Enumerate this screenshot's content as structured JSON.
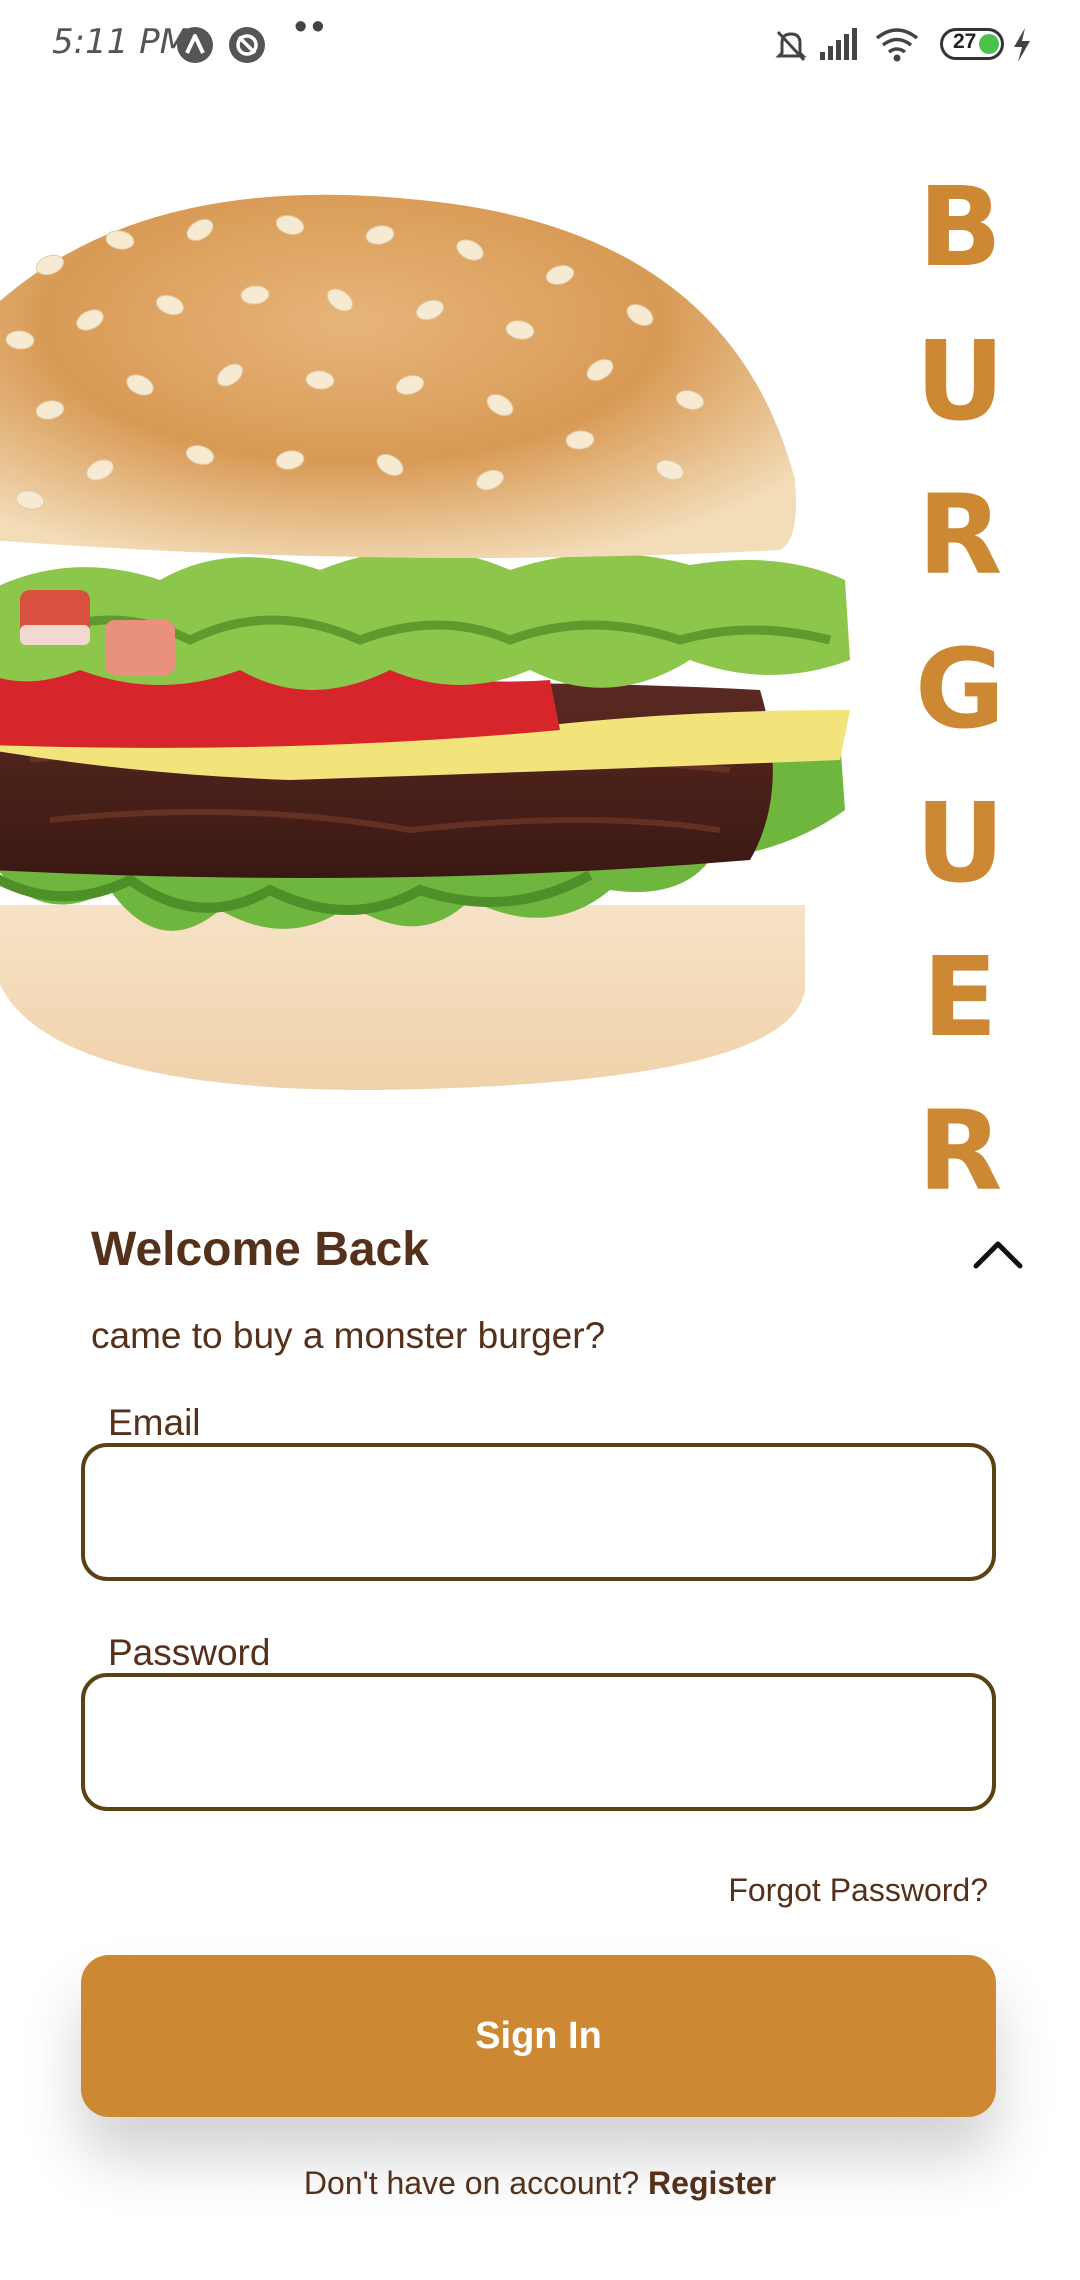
{
  "status_bar": {
    "time": "5:11 PM",
    "dots": "••",
    "battery_level": "27",
    "icons": [
      "app-icon-a",
      "app-icon-block",
      "mute-bell-icon",
      "signal-icon",
      "wifi-icon",
      "battery-icon",
      "charging-icon"
    ]
  },
  "hero": {
    "brand_letters": [
      "B",
      "U",
      "R",
      "G",
      "U",
      "E",
      "R"
    ],
    "image": "burger-illustration"
  },
  "login": {
    "title": "Welcome Back",
    "subtitle": "came to buy a monster burger?",
    "email_label": "Email",
    "email_value": "",
    "password_label": "Password",
    "password_value": "",
    "forgot_password": "Forgot Password?",
    "sign_in": "Sign In",
    "register_prompt": "Don't have on account?",
    "register_link": "Register"
  },
  "colors": {
    "accent": "#cd8833",
    "text_brown": "#55301a",
    "input_border": "#5a4214",
    "background": "#ffffff"
  }
}
